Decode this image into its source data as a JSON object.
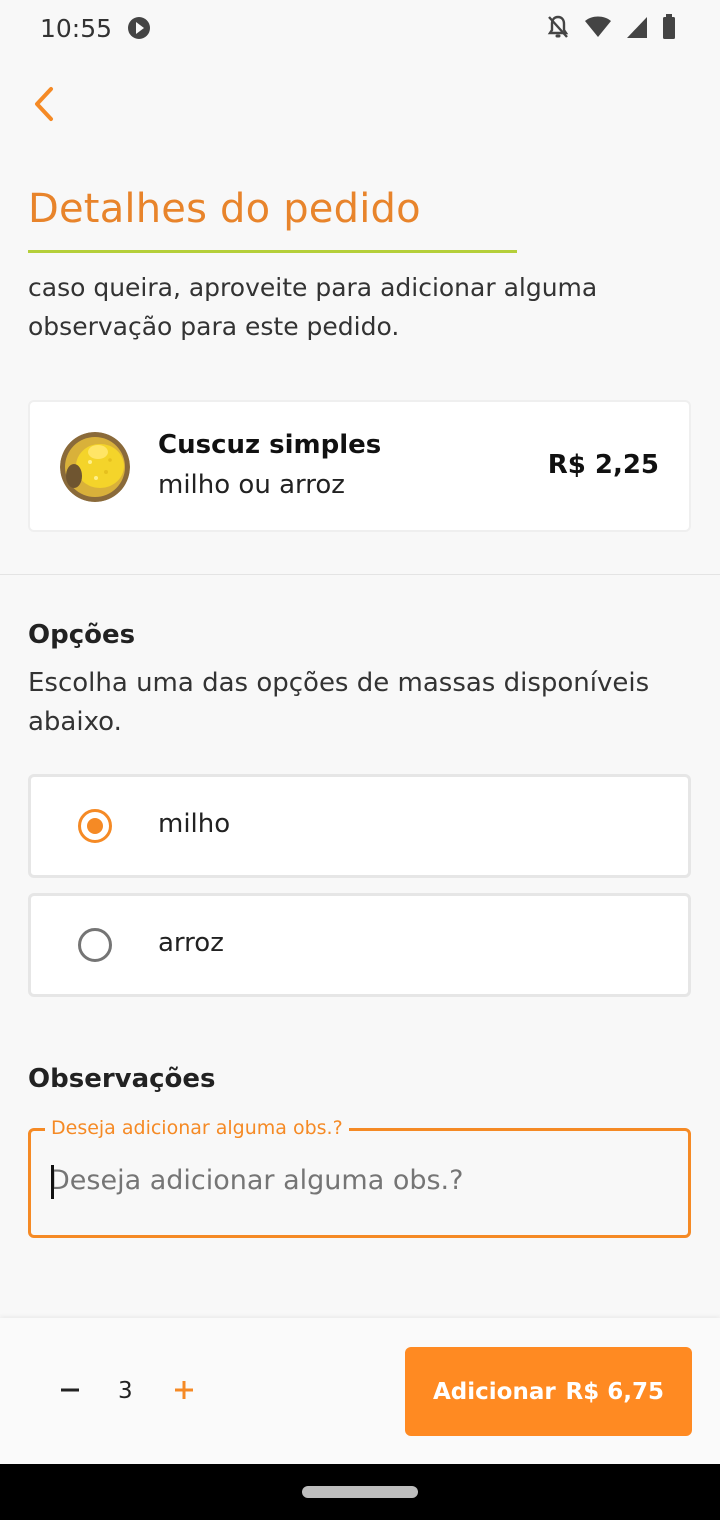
{
  "status_bar": {
    "time": "10:55"
  },
  "header": {
    "title": "Detalhes do pedido",
    "subtitle": "caso queira, aproveite para adicionar alguma observação para este pedido."
  },
  "product": {
    "name": "Cuscuz simples",
    "description": "milho ou arroz",
    "price": "R$ 2,25",
    "image_icon": "cuscuz-photo"
  },
  "options": {
    "title": "Opções",
    "description": "Escolha uma das opções de massas disponíveis abaixo.",
    "items": [
      {
        "label": "milho",
        "selected": true
      },
      {
        "label": "arroz",
        "selected": false
      }
    ]
  },
  "observations": {
    "title": "Observações",
    "label": "Deseja adicionar alguma obs.?",
    "placeholder": "Deseja adicionar alguma obs.?",
    "value": ""
  },
  "footer": {
    "quantity": "3",
    "add_label": "Adicionar",
    "total": "R$ 6,75"
  },
  "colors": {
    "accent": "#f58a25",
    "title": "#e8842b",
    "underline": "#b5cf3a",
    "button": "#ff8a22"
  }
}
